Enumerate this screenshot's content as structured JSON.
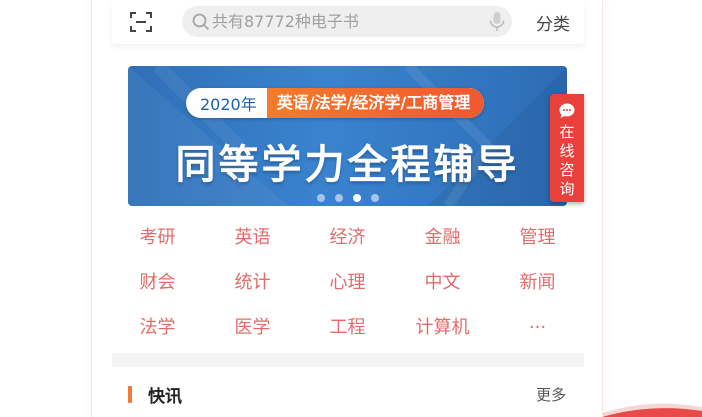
{
  "header": {
    "search_placeholder": "共有87772种电子书",
    "category_label": "分类"
  },
  "banner": {
    "year": "2020年",
    "subjects": "英语/法学/经济学/工商管理",
    "title": "同等学力全程辅导",
    "slides": {
      "count": 4,
      "active_index": 3
    }
  },
  "consult": {
    "label": "在线咨询"
  },
  "categories": [
    [
      "考研",
      "英语",
      "经济",
      "金融",
      "管理"
    ],
    [
      "财会",
      "统计",
      "心理",
      "中文",
      "新闻"
    ],
    [
      "法学",
      "医学",
      "工程",
      "计算机",
      "···"
    ]
  ],
  "news": {
    "title": "快讯",
    "more_label": "更多"
  },
  "colors": {
    "accent_red": "#e8413c",
    "category_text": "#e56b6b",
    "banner_blue": "#3a83cf",
    "news_bar": "#f07a3a"
  }
}
